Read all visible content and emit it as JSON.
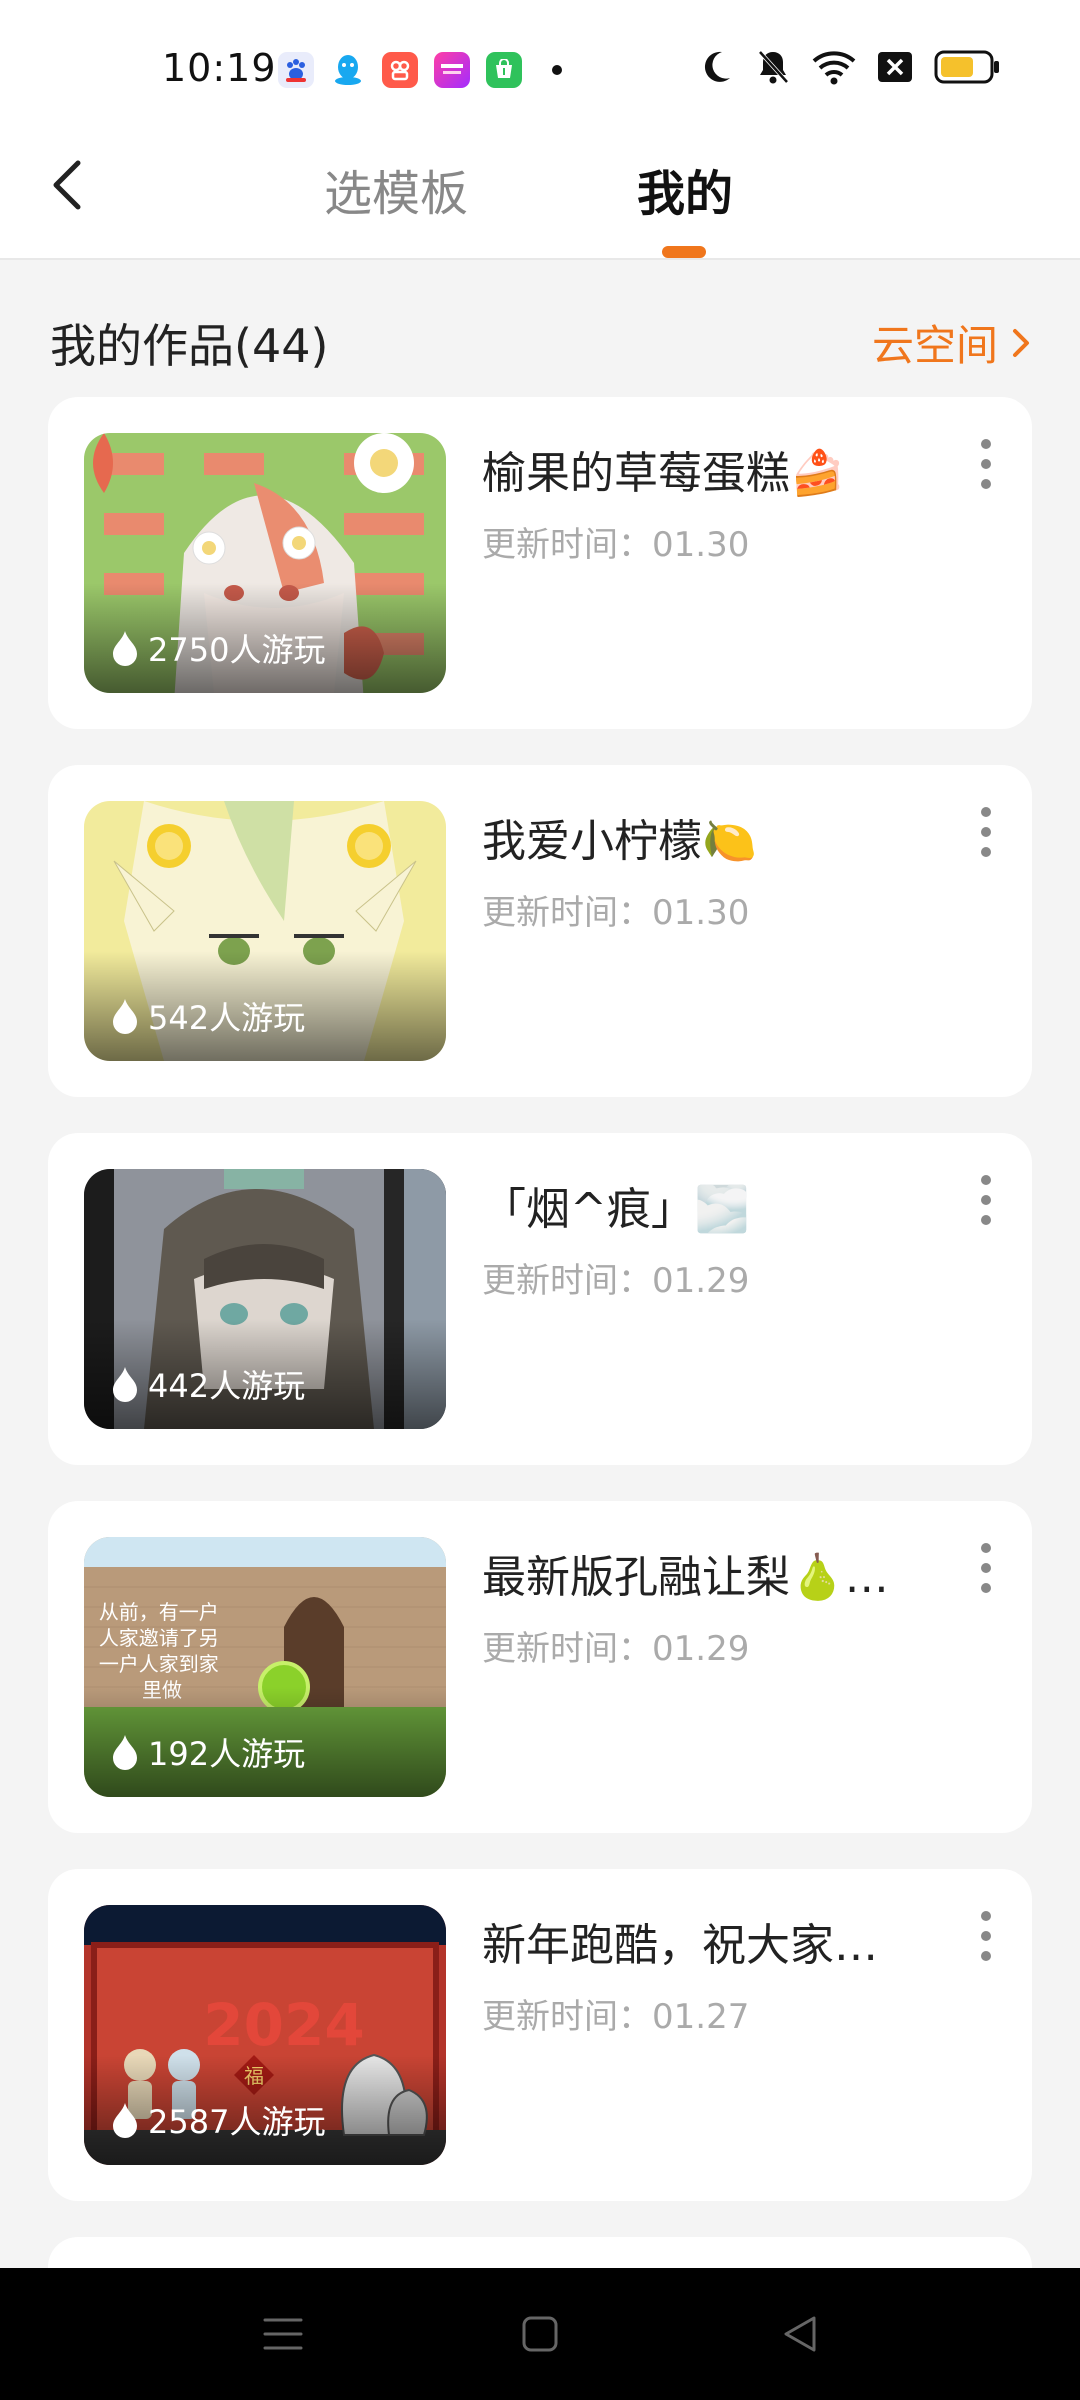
{
  "status_bar": {
    "time": "10:19",
    "app_icons": [
      "baidu-app-icon",
      "qq-app-icon",
      "kuaishou-app-icon",
      "store-app-icon",
      "shop-app-icon"
    ],
    "system_icons": [
      "moon-icon",
      "mute-bell-icon",
      "wifi-icon",
      "sim-off-icon",
      "battery-icon"
    ],
    "battery_level": 0.6
  },
  "header": {
    "tabs": [
      {
        "label": "选模板",
        "selected": false
      },
      {
        "label": "我的",
        "selected": true
      }
    ],
    "accent_color": "#f0761c"
  },
  "section": {
    "title": "我的作品(44)",
    "cloud_link": "云空间"
  },
  "works": [
    {
      "title": "榆果的草莓蛋糕🍰",
      "meta": "更新时间：01.30",
      "plays": "2750人游玩",
      "thumb_icon": "strawberry-anime-thumbnail"
    },
    {
      "title": "我爱小柠檬🍋",
      "meta": "更新时间：01.30",
      "plays": "542人游玩",
      "thumb_icon": "lemon-anime-thumbnail"
    },
    {
      "title": "「烟^痕」🌫️",
      "meta": "更新时间：01.29",
      "plays": "442人游玩",
      "thumb_icon": "grey-anime-thumbnail"
    },
    {
      "title": "最新版孔融让梨🍐…",
      "meta": "更新时间：01.29",
      "plays": "192人游玩",
      "thumb_icon": "pear-story-thumbnail"
    },
    {
      "title": "新年跑酷，祝大家…",
      "meta": "更新时间：01.27",
      "plays": "2587人游玩",
      "thumb_icon": "new-year-2024-thumbnail"
    }
  ],
  "thumb_texts": {
    "pear_story": [
      "从前，有一户",
      "人家邀请了另",
      "一户人家到家",
      "里做"
    ],
    "year": "2024",
    "fu": "福"
  },
  "nav_bar": [
    "menu-icon",
    "home-icon",
    "back-triangle-icon"
  ]
}
